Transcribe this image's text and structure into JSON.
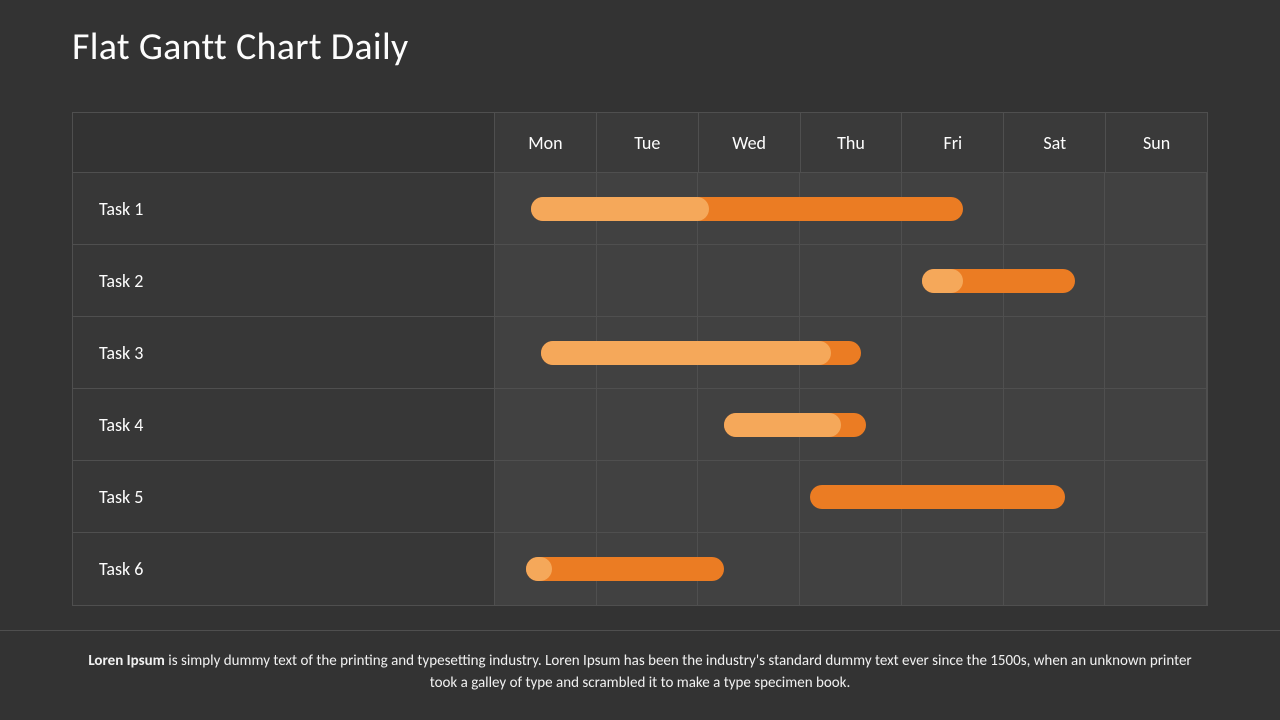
{
  "title": "Flat Gantt Chart Daily",
  "days": [
    "Mon",
    "Tue",
    "Wed",
    "Thu",
    "Fri",
    "Sat",
    "Sun"
  ],
  "tasks": [
    {
      "name": "Task 1",
      "bar_start_day": 0.35,
      "bar_end_day": 4.6,
      "progress_end_day": 2.1
    },
    {
      "name": "Task 2",
      "bar_start_day": 4.2,
      "bar_end_day": 5.7,
      "progress_end_day": 4.6
    },
    {
      "name": "Task 3",
      "bar_start_day": 0.45,
      "bar_end_day": 3.6,
      "progress_end_day": 3.3
    },
    {
      "name": "Task 4",
      "bar_start_day": 2.25,
      "bar_end_day": 3.65,
      "progress_end_day": 3.4
    },
    {
      "name": "Task 5",
      "bar_start_day": 3.1,
      "bar_end_day": 5.6,
      "progress_end_day": 3.1
    },
    {
      "name": "Task 6",
      "bar_start_day": 0.3,
      "bar_end_day": 2.25,
      "progress_end_day": 0.56
    }
  ],
  "footer": {
    "lead": "Loren Ipsum",
    "rest": " is simply dummy text of the printing and typesetting industry. Loren Ipsum has been the industry's standard dummy text ever since the 1500s, when an unknown printer took a galley of type and scrambled it to make a type specimen book."
  },
  "chart_data": {
    "type": "bar",
    "title": "Flat Gantt Chart Daily",
    "categories": [
      "Mon",
      "Tue",
      "Wed",
      "Thu",
      "Fri",
      "Sat",
      "Sun"
    ],
    "series": [
      {
        "name": "Task 1",
        "start": 0.35,
        "end": 4.6,
        "progress": 0.38
      },
      {
        "name": "Task 2",
        "start": 4.2,
        "end": 5.7,
        "progress": 0.27
      },
      {
        "name": "Task 3",
        "start": 0.45,
        "end": 3.6,
        "progress": 0.9
      },
      {
        "name": "Task 4",
        "start": 2.25,
        "end": 3.65,
        "progress": 0.82
      },
      {
        "name": "Task 5",
        "start": 3.1,
        "end": 5.6,
        "progress": 0.0
      },
      {
        "name": "Task 6",
        "start": 0.3,
        "end": 2.25,
        "progress": 0.13
      }
    ],
    "xlabel": "",
    "ylabel": "",
    "ylim": [
      0,
      7
    ]
  }
}
